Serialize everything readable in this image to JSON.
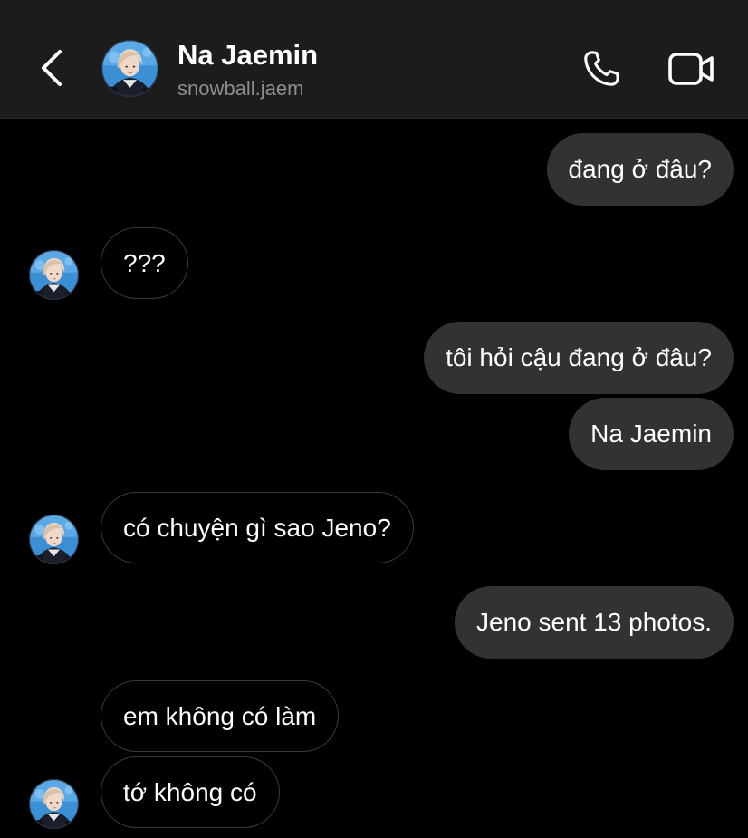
{
  "header": {
    "name": "Na Jaemin",
    "username": "snowball.jaem",
    "back_icon": "chevron-left-icon",
    "call_icon": "phone-icon",
    "video_icon": "video-camera-icon"
  },
  "messages": [
    {
      "from": "me",
      "text": "đang ở đâu?"
    },
    {
      "from": "them",
      "text": "???"
    },
    {
      "from": "me",
      "text": "tôi hỏi cậu đang ở đâu?"
    },
    {
      "from": "me",
      "text": "Na Jaemin"
    },
    {
      "from": "them",
      "text": "có chuyện gì sao Jeno?"
    },
    {
      "from": "me",
      "text": "Jeno sent 13 photos."
    },
    {
      "from": "them",
      "text": "em không có làm"
    },
    {
      "from": "them",
      "text": "tớ không có"
    }
  ],
  "colors": {
    "background": "#000000",
    "header_bg": "#1c1c1c",
    "sent_bubble": "#323232",
    "received_border": "#3a3a3a",
    "secondary_text": "#8e8e8e"
  }
}
